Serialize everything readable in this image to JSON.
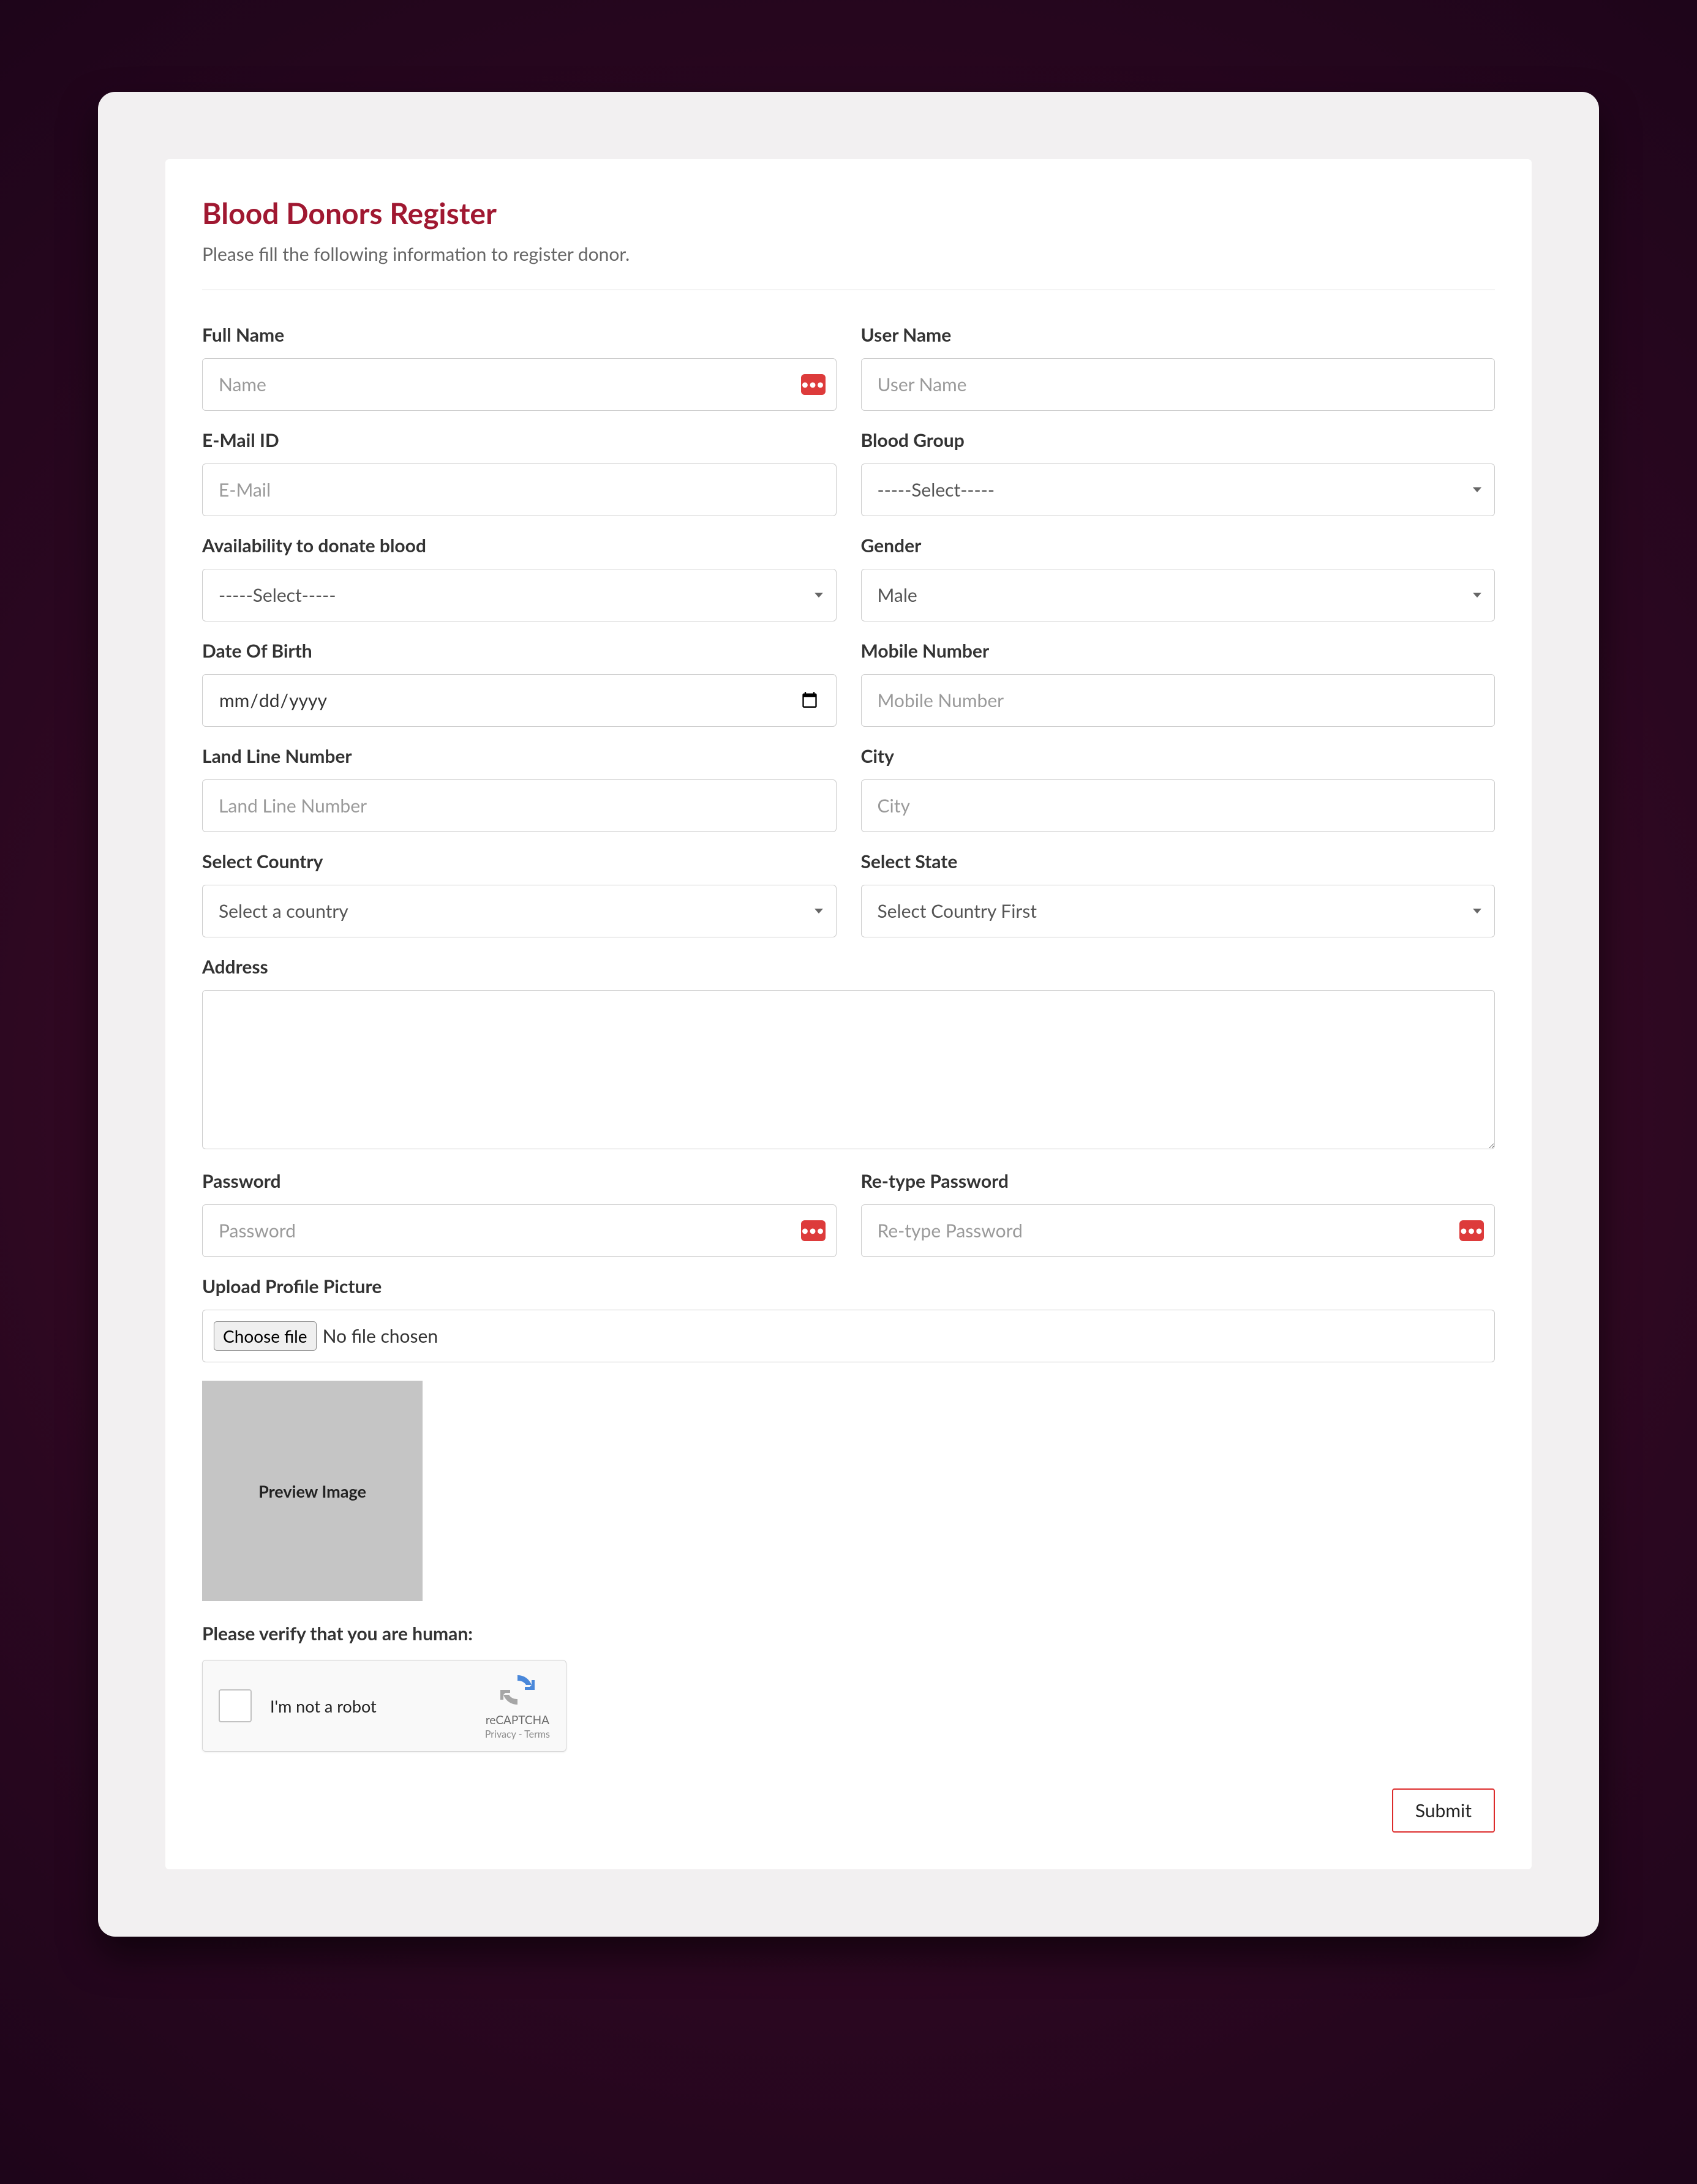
{
  "page": {
    "title": "Blood Donors Register",
    "subtitle": "Please fill the following information to register donor."
  },
  "labels": {
    "full_name": "Full Name",
    "user_name": "User Name",
    "email": "E-Mail ID",
    "blood_group": "Blood Group",
    "availability": "Availability to donate blood",
    "gender": "Gender",
    "dob": "Date Of Birth",
    "mobile": "Mobile Number",
    "landline": "Land Line Number",
    "city": "City",
    "country": "Select Country",
    "state": "Select State",
    "address": "Address",
    "password": "Password",
    "retype_password": "Re-type Password",
    "upload": "Upload Profile Picture",
    "captcha": "Please verify that you are human:"
  },
  "placeholders": {
    "full_name": "Name",
    "user_name": "User Name",
    "email": "E-Mail",
    "mobile": "Mobile Number",
    "landline": "Land Line Number",
    "city": "City",
    "password": "Password",
    "retype_password": "Re-type Password",
    "dob": "mm/dd/yyyy"
  },
  "selects": {
    "blood_group": {
      "selected": "-----Select-----"
    },
    "availability": {
      "selected": "-----Select-----"
    },
    "gender": {
      "selected": "Male"
    },
    "country": {
      "selected": "Select a country"
    },
    "state": {
      "selected": "Select Country First"
    }
  },
  "file": {
    "button": "Choose file",
    "status": "No file chosen",
    "preview": "Preview Image"
  },
  "recaptcha": {
    "text": "I'm not a robot",
    "brand": "reCAPTCHA",
    "links": "Privacy - Terms"
  },
  "submit": "Submit"
}
